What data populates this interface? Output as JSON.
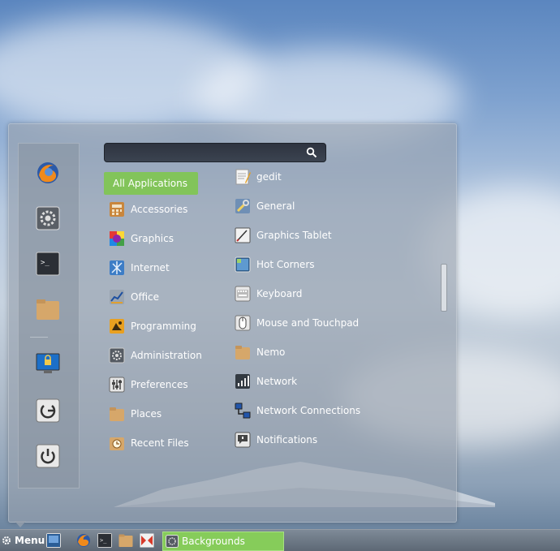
{
  "search": {
    "placeholder": "",
    "value": ""
  },
  "favorites": [
    {
      "icon": "firefox-icon"
    },
    {
      "icon": "system-settings-icon"
    },
    {
      "icon": "terminal-icon"
    },
    {
      "icon": "folder-icon"
    },
    {
      "icon": "lock-screen-icon"
    },
    {
      "icon": "logout-icon"
    },
    {
      "icon": "power-icon"
    }
  ],
  "categories": [
    {
      "label": "All Applications",
      "active": true
    },
    {
      "label": "Accessories",
      "icon": "accessories-icon"
    },
    {
      "label": "Graphics",
      "icon": "graphics-icon"
    },
    {
      "label": "Internet",
      "icon": "internet-icon"
    },
    {
      "label": "Office",
      "icon": "office-icon"
    },
    {
      "label": "Programming",
      "icon": "programming-icon"
    },
    {
      "label": "Administration",
      "icon": "administration-icon"
    },
    {
      "label": "Preferences",
      "icon": "preferences-icon"
    },
    {
      "label": "Places",
      "icon": "folder-icon"
    },
    {
      "label": "Recent Files",
      "icon": "recent-files-icon"
    }
  ],
  "applications": [
    {
      "label": "gedit",
      "icon": "gedit-icon"
    },
    {
      "label": "General",
      "icon": "general-icon"
    },
    {
      "label": "Graphics Tablet",
      "icon": "graphics-tablet-icon"
    },
    {
      "label": "Hot Corners",
      "icon": "hot-corners-icon"
    },
    {
      "label": "Keyboard",
      "icon": "keyboard-icon"
    },
    {
      "label": "Mouse and Touchpad",
      "icon": "mouse-icon"
    },
    {
      "label": "Nemo",
      "icon": "folder-icon"
    },
    {
      "label": "Network",
      "icon": "network-icon"
    },
    {
      "label": "Network Connections",
      "icon": "network-connections-icon"
    },
    {
      "label": "Notifications",
      "icon": "notifications-icon"
    }
  ],
  "taskbar": {
    "menu_label": "Menu",
    "launchers": [
      "show-desktop-icon",
      "firefox-icon",
      "terminal-icon",
      "folder-icon",
      "app-icon"
    ],
    "window_label": "Backgrounds"
  },
  "colors": {
    "accent": "#82c45a",
    "window_button": "#86cc5a"
  }
}
